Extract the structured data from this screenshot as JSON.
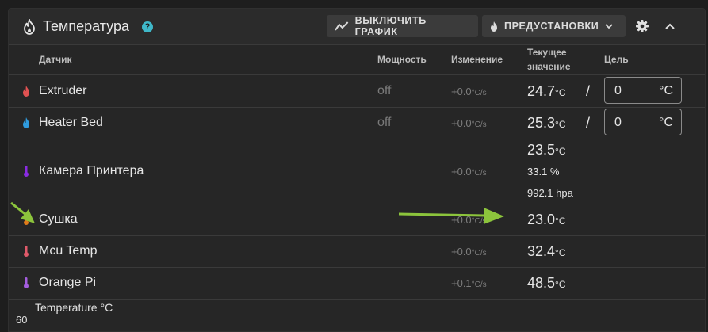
{
  "header": {
    "title": "Температура",
    "help_icon": "help-circle-icon",
    "chart_button_label": "ВЫКЛЮЧИТЬ ГРАФИК",
    "presets_button_label": "ПРЕДУСТАНОВКИ"
  },
  "columns": {
    "sensor": "Датчик",
    "power": "Мощность",
    "change": "Изменение",
    "current_line1": "Текущее",
    "current_line2": "значение",
    "target": "Цель"
  },
  "rows": [
    {
      "name": "Extruder",
      "power": "off",
      "rate": "+0.0",
      "rate_unit": "°C/s",
      "current": "24.7",
      "current_unit": "°C",
      "slash": "/",
      "target": "0",
      "target_unit": "°C",
      "icon": "flame-icon",
      "color": "#e05252"
    },
    {
      "name": "Heater Bed",
      "power": "off",
      "rate": "+0.0",
      "rate_unit": "°C/s",
      "current": "25.3",
      "current_unit": "°C",
      "slash": "/",
      "target": "0",
      "target_unit": "°C",
      "icon": "flame-icon",
      "color": "#2f9bde"
    },
    {
      "name": "Камера Принтера",
      "rate": "+0.0",
      "rate_unit": "°C/s",
      "current": "23.5",
      "current_unit": "°C",
      "humidity": "33.1 %",
      "pressure": "992.1 hpa",
      "icon": "thermometer-icon",
      "color": "#8a2be2"
    },
    {
      "name": "Сушка",
      "rate": "+0.0",
      "rate_unit": "°C/s",
      "current": "23.0",
      "current_unit": "°C",
      "icon": "thermometer-icon",
      "color": "#e07b1a"
    },
    {
      "name": "Mcu Temp",
      "rate": "+0.0",
      "rate_unit": "°C/s",
      "current": "32.4",
      "current_unit": "°C",
      "icon": "thermometer-icon",
      "color": "#e05a6a"
    },
    {
      "name": "Orange Pi",
      "rate": "+0.1",
      "rate_unit": "°C/s",
      "current": "48.5",
      "current_unit": "°C",
      "icon": "thermometer-icon",
      "color": "#a55ee0"
    }
  ],
  "chart": {
    "title": "Temperature °C",
    "top_tick": "60"
  },
  "colors": {
    "accent_help": "#3fb8c9",
    "annotation_arrow": "#8cc43c"
  }
}
